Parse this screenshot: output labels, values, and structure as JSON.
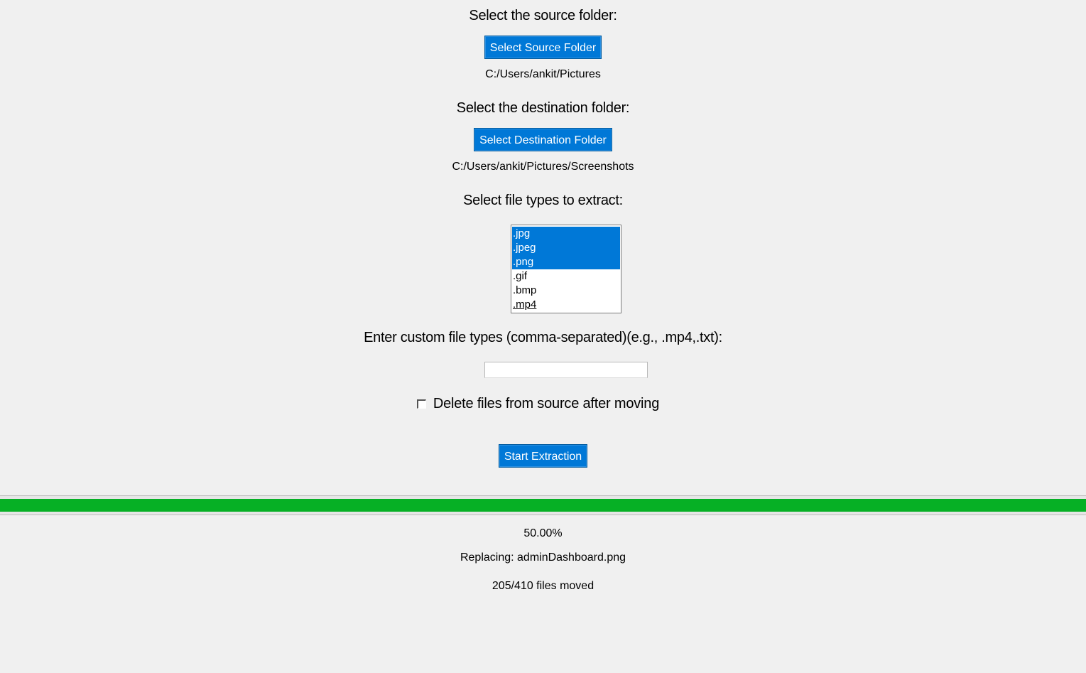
{
  "source": {
    "heading": "Select the source folder:",
    "button_label": "Select Source Folder",
    "path": "C:/Users/ankit/Pictures"
  },
  "destination": {
    "heading": "Select the destination folder:",
    "button_label": "Select Destination Folder",
    "path": "C:/Users/ankit/Pictures/Screenshots"
  },
  "file_types": {
    "heading": "Select file types to extract:",
    "options": [
      {
        "label": ".jpg",
        "selected": true
      },
      {
        "label": ".jpeg",
        "selected": true
      },
      {
        "label": ".png",
        "selected": true
      },
      {
        "label": ".gif",
        "selected": false
      },
      {
        "label": ".bmp",
        "selected": false
      },
      {
        "label": ".mp4",
        "selected": false
      }
    ]
  },
  "custom_types": {
    "heading": "Enter custom file types (comma-separated)(e.g., .mp4,.txt):",
    "value": ""
  },
  "delete_option": {
    "label": "Delete files from source after moving",
    "checked": false
  },
  "start_button_label": "Start Extraction",
  "progress": {
    "fraction": 0.5,
    "percent_text": "50.00%",
    "current_action": "Replacing: adminDashboard.png",
    "count_text": "205/410 files moved"
  },
  "colors": {
    "accent": "#0078d7",
    "progress": "#06b025",
    "background": "#f0f0f0"
  }
}
